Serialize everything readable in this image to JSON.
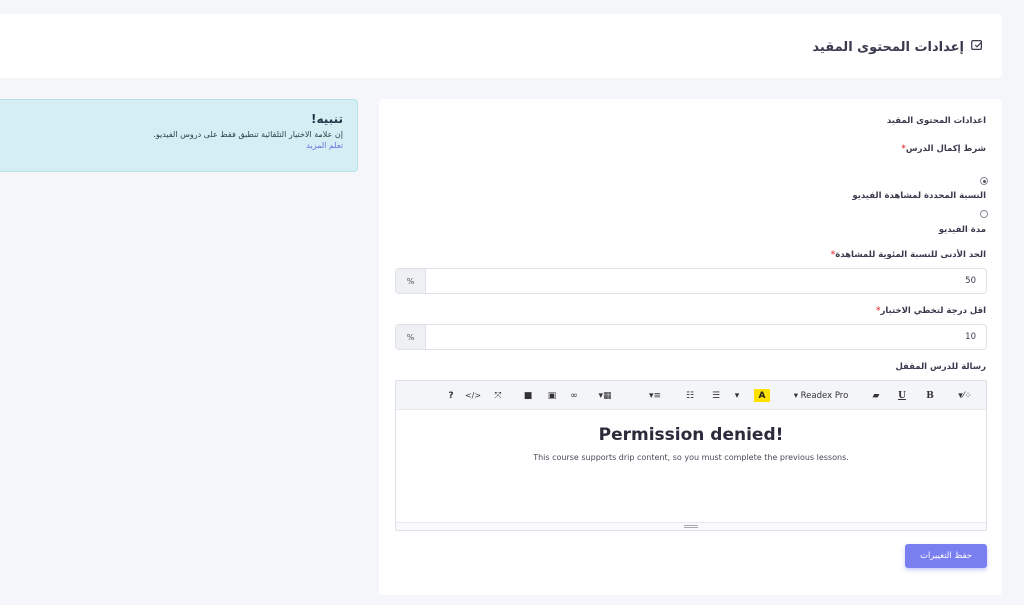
{
  "header": {
    "title": "إعدادات المحتوى المقيد",
    "icon": "edit-square-icon"
  },
  "alert": {
    "title": "تنبيه!",
    "text": "إن علامة الاختيار التلقائية تنطبق فقط على دروس الفيديو.",
    "link": "تعلم المزيد"
  },
  "form": {
    "section_title": "اعدادات المحتوى المقيد",
    "completion_label": "شرط إكمال الدرس",
    "required_mark": "*",
    "radio_options": [
      {
        "label": "النسبة المحددة لمشاهدة الفيديو",
        "selected": true
      },
      {
        "label": "مدة الفيديو",
        "selected": false
      }
    ],
    "min_percent_label": "الحد الأدنى للنسبة المئوية للمشاهدة",
    "min_percent_value": "50",
    "min_percent_addon": "%",
    "min_score_label": "اقل درجة لتخطي الاختبار",
    "min_score_value": "10",
    "min_score_addon": "%",
    "locked_msg_label": "رسالة للدرس المقفل",
    "save_label": "حفظ التغييرات"
  },
  "editor": {
    "font_name": "Readex Pro",
    "toolbar": {
      "bold": "B",
      "underline": "U",
      "help": "?",
      "code": "</>",
      "highlight": "A"
    },
    "content_title": "Permission denied!",
    "content_text": "This course supports drip content, so you must complete the previous lessons."
  },
  "colors": {
    "accent": "#7a7ff0",
    "required": "#e84b4b",
    "alert_bg": "#d4eef4",
    "link": "#6a73e3"
  }
}
